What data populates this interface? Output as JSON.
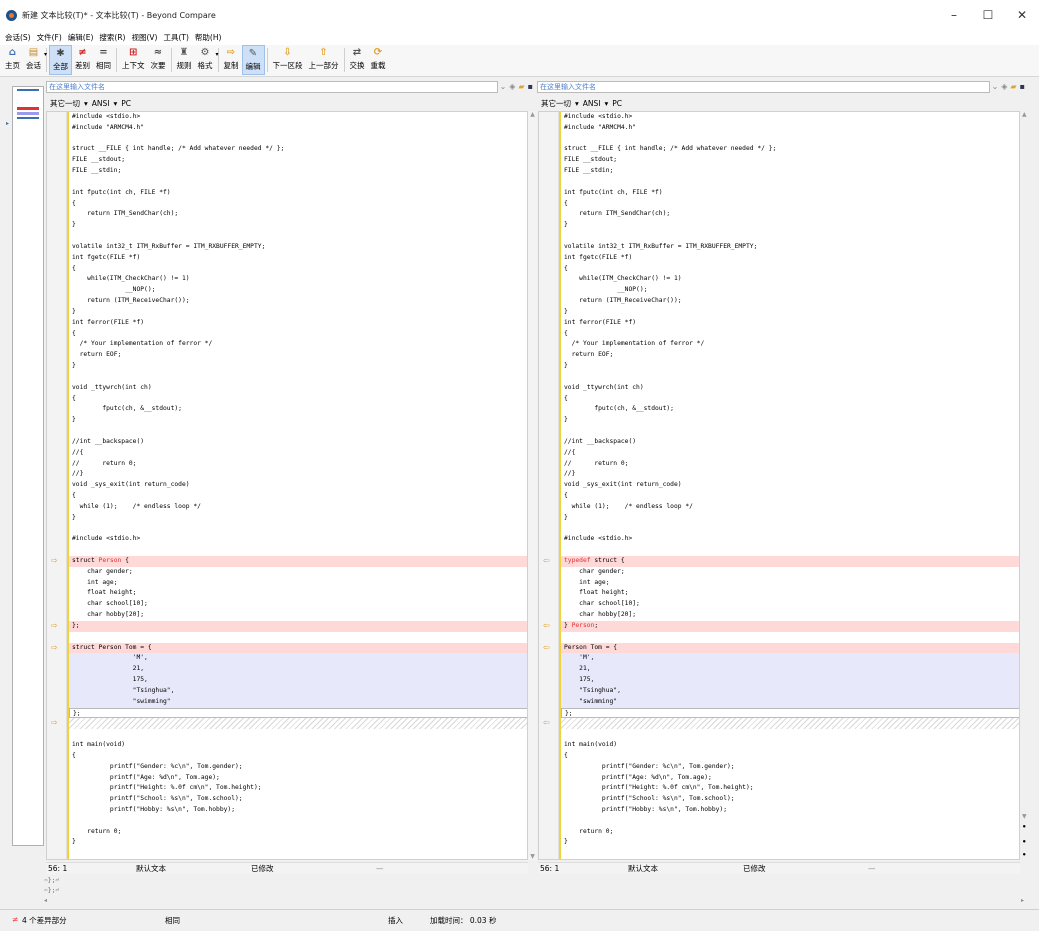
{
  "window": {
    "title": "新建 文本比较(T)* - 文本比较(T) - Beyond Compare",
    "controls": [
      "–",
      "☐",
      "✕"
    ]
  },
  "menu": [
    "会话(S)",
    "文件(F)",
    "编辑(E)",
    "搜索(R)",
    "视图(V)",
    "工具(T)",
    "帮助(H)"
  ],
  "toolbar": [
    {
      "name": "home",
      "label": "主页",
      "glyph": "⌂",
      "color": "#3a6fb3"
    },
    {
      "name": "session",
      "label": "会话",
      "glyph": "▤",
      "color": "#c48b1f",
      "caret": true
    },
    {
      "name": "all",
      "label": "全部",
      "glyph": "✱",
      "color": "#444",
      "active": true
    },
    {
      "name": "diffs",
      "label": "差别",
      "glyph": "≠",
      "color": "#d02020"
    },
    {
      "name": "same",
      "label": "相同",
      "glyph": "=",
      "color": "#444"
    },
    {
      "name": "context",
      "label": "上下文",
      "glyph": "⊞",
      "color": "#d02020"
    },
    {
      "name": "minor",
      "label": "次要",
      "glyph": "≈",
      "color": "#444"
    },
    {
      "name": "rules",
      "label": "规则",
      "glyph": "♜",
      "color": "#555"
    },
    {
      "name": "format",
      "label": "格式",
      "glyph": "⚙",
      "color": "#555",
      "caret": true
    },
    {
      "name": "copy",
      "label": "复制",
      "glyph": "⇨",
      "color": "#e0a02a"
    },
    {
      "name": "edit",
      "label": "编辑",
      "glyph": "✎",
      "color": "#555",
      "active": true
    },
    {
      "name": "next-section",
      "label": "下一区段",
      "glyph": "⇩",
      "color": "#e0a02a"
    },
    {
      "name": "prev-part",
      "label": "上一部分",
      "glyph": "⇧",
      "color": "#e0a02a"
    },
    {
      "name": "swap",
      "label": "交换",
      "glyph": "⇄",
      "color": "#555"
    },
    {
      "name": "reload",
      "label": "重载",
      "glyph": "⟳",
      "color": "#e0a02a"
    }
  ],
  "left": {
    "path_placeholder": "在这里输入文件名",
    "encoding": [
      "其它一切",
      "ANSI",
      "PC"
    ],
    "status": {
      "position": "56: 1",
      "format": "默认文本",
      "state": "已修改"
    }
  },
  "right": {
    "path_placeholder": "在这里输入文件名",
    "encoding": [
      "其它一切",
      "ANSI",
      "PC"
    ],
    "status": {
      "position": "56: 1",
      "format": "默认文本",
      "state": "已修改"
    }
  },
  "left_lines": [
    {
      "t": "#include <stdio.h>"
    },
    {
      "t": "#include \"ARMCM4.h\""
    },
    {
      "t": ""
    },
    {
      "t": "struct __FILE { int handle; /* Add whatever needed */ };"
    },
    {
      "t": "FILE __stdout;"
    },
    {
      "t": "FILE __stdin;"
    },
    {
      "t": ""
    },
    {
      "t": "int fputc(int ch, FILE *f)"
    },
    {
      "t": "{"
    },
    {
      "t": "    return ITM_SendChar(ch);"
    },
    {
      "t": "}"
    },
    {
      "t": ""
    },
    {
      "t": "volatile int32_t ITM_RxBuffer = ITM_RXBUFFER_EMPTY;"
    },
    {
      "t": "int fgetc(FILE *f)"
    },
    {
      "t": "{"
    },
    {
      "t": "    while(ITM_CheckChar() != 1)"
    },
    {
      "t": "              __NOP();"
    },
    {
      "t": "    return (ITM_ReceiveChar());"
    },
    {
      "t": "}"
    },
    {
      "t": "int ferror(FILE *f)"
    },
    {
      "t": "{"
    },
    {
      "t": "  /* Your implementation of ferror */"
    },
    {
      "t": "  return EOF;"
    },
    {
      "t": "}"
    },
    {
      "t": ""
    },
    {
      "t": "void _ttywrch(int ch)"
    },
    {
      "t": "{"
    },
    {
      "t": "        fputc(ch, &__stdout);"
    },
    {
      "t": "}"
    },
    {
      "t": ""
    },
    {
      "t": "//int __backspace()"
    },
    {
      "t": "//{"
    },
    {
      "t": "//      return 0;"
    },
    {
      "t": "//}"
    },
    {
      "t": "void _sys_exit(int return_code)"
    },
    {
      "t": "{"
    },
    {
      "t": "  while (1);    /* endless loop */"
    },
    {
      "t": "}"
    },
    {
      "t": ""
    },
    {
      "t": "#include <stdio.h>"
    },
    {
      "t": ""
    },
    {
      "t": "struct ",
      "h": "Person",
      "r": " {",
      "c": "diff",
      "a": "⇨"
    },
    {
      "t": "    char gender;"
    },
    {
      "t": "    int age;"
    },
    {
      "t": "    float height;"
    },
    {
      "t": "    char school[10];"
    },
    {
      "t": "    char hobby[20];"
    },
    {
      "t": "};",
      "c": "diff",
      "a": "⇨"
    },
    {
      "t": ""
    },
    {
      "t": "struct Person Tom = {",
      "c": "diff",
      "a": "⇨"
    },
    {
      "t": "                'M',",
      "c": "blue"
    },
    {
      "t": "                21,",
      "c": "blue"
    },
    {
      "t": "                175,",
      "c": "blue"
    },
    {
      "t": "                \"Tsinghua\",",
      "c": "blue"
    },
    {
      "t": "                \"swimming\"",
      "c": "blue"
    },
    {
      "t": "};",
      "c": "caret-line"
    },
    {
      "t": "",
      "c": "hatch",
      "a": "⇨"
    },
    {
      "t": ""
    },
    {
      "t": "int main(void)"
    },
    {
      "t": "{"
    },
    {
      "t": "          printf(\"Gender: %c\\n\", Tom.gender);"
    },
    {
      "t": "          printf(\"Age: %d\\n\", Tom.age);"
    },
    {
      "t": "          printf(\"Height: %.0f cm\\n\", Tom.height);"
    },
    {
      "t": "          printf(\"School: %s\\n\", Tom.school);"
    },
    {
      "t": "          printf(\"Hobby: %s\\n\", Tom.hobby);"
    },
    {
      "t": ""
    },
    {
      "t": "    return 0;"
    },
    {
      "t": "}"
    }
  ],
  "right_lines": [
    {
      "t": "#include <stdio.h>"
    },
    {
      "t": "#include \"ARMCM4.h\""
    },
    {
      "t": ""
    },
    {
      "t": "struct __FILE { int handle; /* Add whatever needed */ };"
    },
    {
      "t": "FILE __stdout;"
    },
    {
      "t": "FILE __stdin;"
    },
    {
      "t": ""
    },
    {
      "t": "int fputc(int ch, FILE *f)"
    },
    {
      "t": "{"
    },
    {
      "t": "    return ITM_SendChar(ch);"
    },
    {
      "t": "}"
    },
    {
      "t": ""
    },
    {
      "t": "volatile int32_t ITM_RxBuffer = ITM_RXBUFFER_EMPTY;"
    },
    {
      "t": "int fgetc(FILE *f)"
    },
    {
      "t": "{"
    },
    {
      "t": "    while(ITM_CheckChar() != 1)"
    },
    {
      "t": "              __NOP();"
    },
    {
      "t": "    return (ITM_ReceiveChar());"
    },
    {
      "t": "}"
    },
    {
      "t": "int ferror(FILE *f)"
    },
    {
      "t": "{"
    },
    {
      "t": "  /* Your implementation of ferror */"
    },
    {
      "t": "  return EOF;"
    },
    {
      "t": "}"
    },
    {
      "t": ""
    },
    {
      "t": "void _ttywrch(int ch)"
    },
    {
      "t": "{"
    },
    {
      "t": "        fputc(ch, &__stdout);"
    },
    {
      "t": "}"
    },
    {
      "t": ""
    },
    {
      "t": "//int __backspace()"
    },
    {
      "t": "//{"
    },
    {
      "t": "//      return 0;"
    },
    {
      "t": "//}"
    },
    {
      "t": "void _sys_exit(int return_code)"
    },
    {
      "t": "{"
    },
    {
      "t": "  while (1);    /* endless loop */"
    },
    {
      "t": "}"
    },
    {
      "t": ""
    },
    {
      "t": "#include <stdio.h>"
    },
    {
      "t": ""
    },
    {
      "t": "",
      "h": "typedef",
      "r": " struct {",
      "c": "diff",
      "a": "⇦"
    },
    {
      "t": "    char gender;"
    },
    {
      "t": "    int age;"
    },
    {
      "t": "    float height;"
    },
    {
      "t": "    char school[10];"
    },
    {
      "t": "    char hobby[20];"
    },
    {
      "t": "} ",
      "h": "Person",
      "r": ";",
      "c": "diff",
      "a": "⇦"
    },
    {
      "t": ""
    },
    {
      "t": "Person Tom = {",
      "c": "diff",
      "a": "⇦"
    },
    {
      "t": "    'M',",
      "c": "blue"
    },
    {
      "t": "    21,",
      "c": "blue"
    },
    {
      "t": "    175,",
      "c": "blue"
    },
    {
      "t": "    \"Tsinghua\",",
      "c": "blue"
    },
    {
      "t": "    \"swimming\"",
      "c": "blue"
    },
    {
      "t": "};",
      "c": "caret-line"
    },
    {
      "t": "",
      "c": "hatch",
      "a": "⇦"
    },
    {
      "t": ""
    },
    {
      "t": "int main(void)"
    },
    {
      "t": "{"
    },
    {
      "t": "          printf(\"Gender: %c\\n\", Tom.gender);"
    },
    {
      "t": "          printf(\"Age: %d\\n\", Tom.age);"
    },
    {
      "t": "          printf(\"Height: %.0f cm\\n\", Tom.height);"
    },
    {
      "t": "          printf(\"School: %s\\n\", Tom.school);"
    },
    {
      "t": "          printf(\"Hobby: %s\\n\", Tom.hobby);"
    },
    {
      "t": ""
    },
    {
      "t": "    return 0;"
    },
    {
      "t": "}"
    }
  ],
  "summary": {
    "left": "⇨};⏎",
    "right": "⇦};⏎"
  },
  "statusbar": {
    "diff_count": "4 个差异部分",
    "same": "相同",
    "mode": "插入",
    "load_time": "加载时间： 0.03 秒"
  },
  "colors": {
    "diff_bg": "#ffd8d8",
    "change_bg": "#e8e8fb",
    "highlight": "#e53030",
    "arrow": "#e0a02a"
  }
}
